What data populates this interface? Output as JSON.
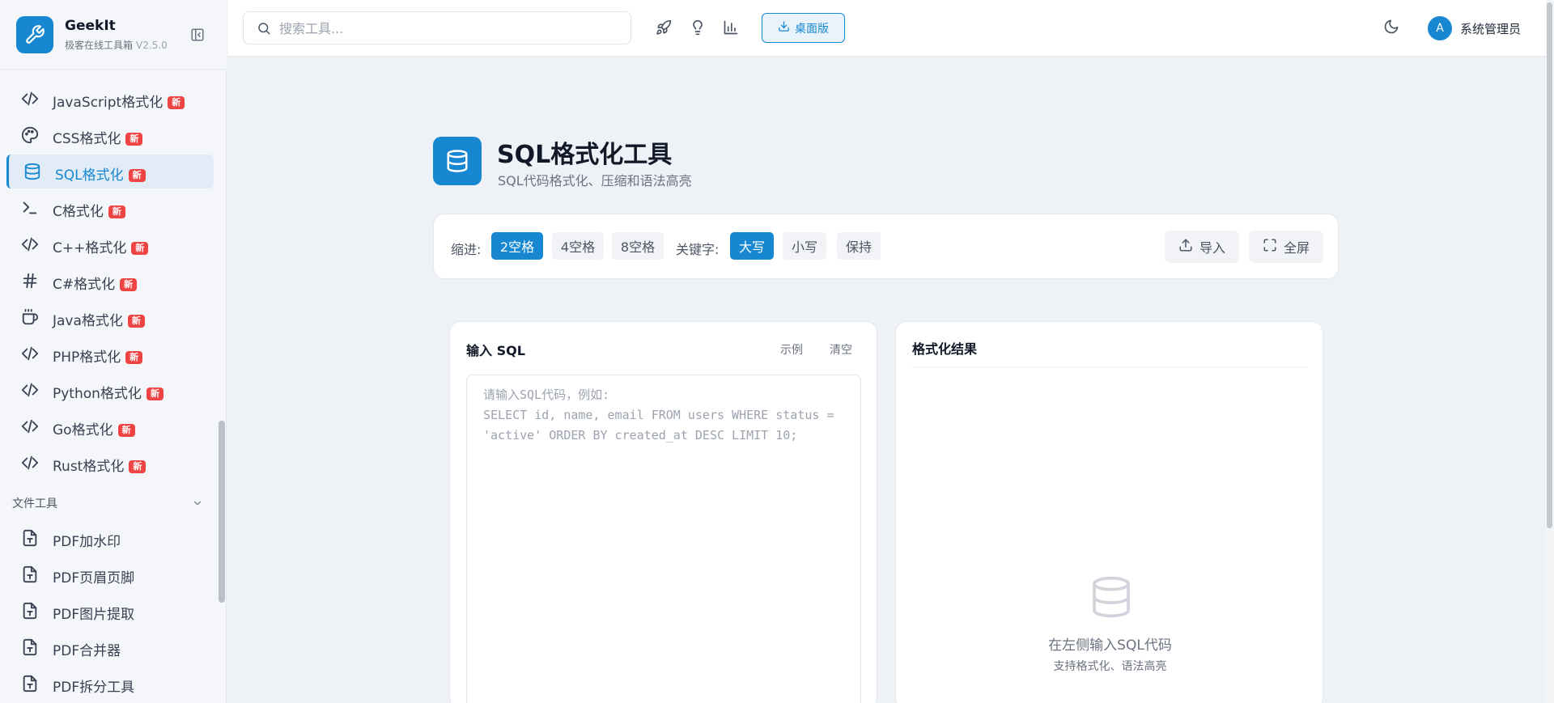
{
  "brand": {
    "name": "GeekIt",
    "subtitle": "极客在线工具箱",
    "version": "V2.5.0"
  },
  "sidebar": {
    "items": [
      {
        "label": "JavaScript格式化",
        "badge": "新",
        "icon": "code-icon"
      },
      {
        "label": "CSS格式化",
        "badge": "新",
        "icon": "palette-icon"
      },
      {
        "label": "SQL格式化",
        "badge": "新",
        "icon": "database-icon",
        "active": true
      },
      {
        "label": "C格式化",
        "badge": "新",
        "icon": "terminal-icon"
      },
      {
        "label": "C++格式化",
        "badge": "新",
        "icon": "code-icon"
      },
      {
        "label": "C#格式化",
        "badge": "新",
        "icon": "hash-icon"
      },
      {
        "label": "Java格式化",
        "badge": "新",
        "icon": "coffee-icon"
      },
      {
        "label": "PHP格式化",
        "badge": "新",
        "icon": "code-icon"
      },
      {
        "label": "Python格式化",
        "badge": "新",
        "icon": "code-icon"
      },
      {
        "label": "Go格式化",
        "badge": "新",
        "icon": "code-icon"
      },
      {
        "label": "Rust格式化",
        "badge": "新",
        "icon": "code-icon"
      }
    ],
    "file_section": {
      "title": "文件工具",
      "items": [
        {
          "label": "PDF加水印",
          "icon": "file-text-icon"
        },
        {
          "label": "PDF页眉页脚",
          "icon": "file-text-icon"
        },
        {
          "label": "PDF图片提取",
          "icon": "file-text-icon"
        },
        {
          "label": "PDF合并器",
          "icon": "file-text-icon"
        },
        {
          "label": "PDF拆分工具",
          "icon": "file-text-icon"
        }
      ]
    }
  },
  "topbar": {
    "search_placeholder": "搜索工具...",
    "desktop_label": "桌面版",
    "user_initial": "A",
    "user_name": "系统管理员"
  },
  "tool": {
    "title": "SQL格式化工具",
    "subtitle": "SQL代码格式化、压缩和语法高亮"
  },
  "toolbar": {
    "indent_label": "缩进:",
    "indent_options": [
      "2空格",
      "4空格",
      "8空格"
    ],
    "indent_selected": "2空格",
    "keyword_label": "关键字:",
    "keyword_options": [
      "大写",
      "小写",
      "保持"
    ],
    "keyword_selected": "大写",
    "import_label": "导入",
    "fullscreen_label": "全屏"
  },
  "input_panel": {
    "title": "输入 SQL",
    "example_label": "示例",
    "clear_label": "清空",
    "placeholder": "请输入SQL代码，例如:\nSELECT id, name, email FROM users WHERE status = 'active' ORDER BY created_at DESC LIMIT 10;"
  },
  "output_panel": {
    "title": "格式化结果",
    "empty_title": "在左侧输入SQL代码",
    "empty_subtitle": "支持格式化、语法高亮"
  },
  "colors": {
    "accent": "#1787d1",
    "badge": "#ef4444",
    "background": "#eef2f7"
  }
}
